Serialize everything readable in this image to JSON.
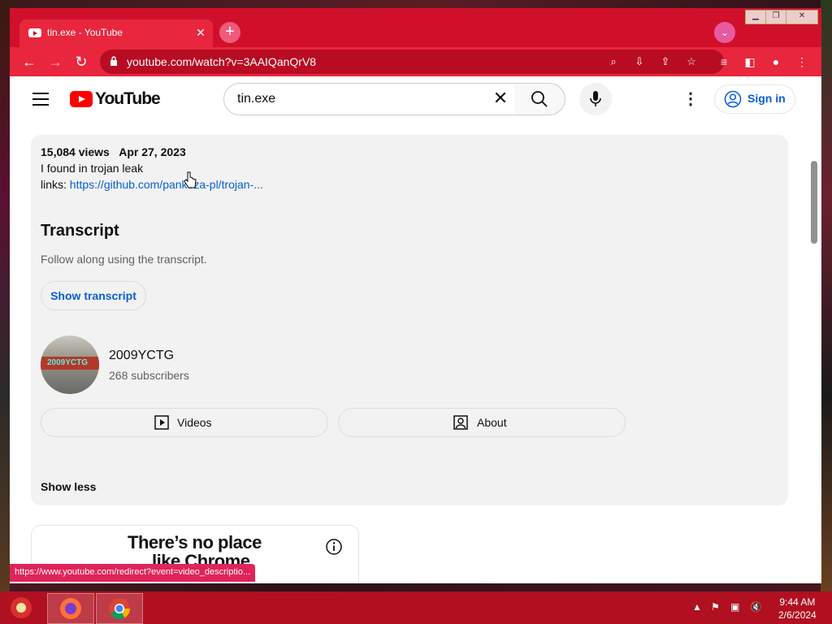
{
  "browser": {
    "tab_title": "tin.exe - YouTube",
    "url": "youtube.com/watch?v=3AAIQanQrV8",
    "status_url": "https://www.youtube.com/redirect?event=video_descriptio..."
  },
  "youtube": {
    "logo_text": "YouTube",
    "search_value": "tin.exe",
    "signin_label": "Sign in"
  },
  "description": {
    "views": "15,084 views",
    "date": "Apr 27, 2023",
    "text": "I found in trojan leak",
    "links_prefix": "links: ",
    "link_text": "https://github.com/pankoza-pl/trojan-...",
    "transcript_heading": "Transcript",
    "transcript_sub": "Follow along using the transcript.",
    "show_transcript": "Show transcript",
    "channel_name": "2009YCTG",
    "subscribers": "268 subscribers",
    "avatar_text": "2009YCTG",
    "videos_btn": "Videos",
    "about_btn": "About",
    "show_less": "Show less"
  },
  "ad": {
    "line1": "There’s no place",
    "line2": "like Chrome"
  },
  "taskbar": {
    "time": "9:44 AM",
    "date": "2/6/2024"
  },
  "colors": {
    "chrome_theme": "#d0102a",
    "tab_active": "#e8263e",
    "yt_red": "#ff0000",
    "link_blue": "#065fd4"
  }
}
